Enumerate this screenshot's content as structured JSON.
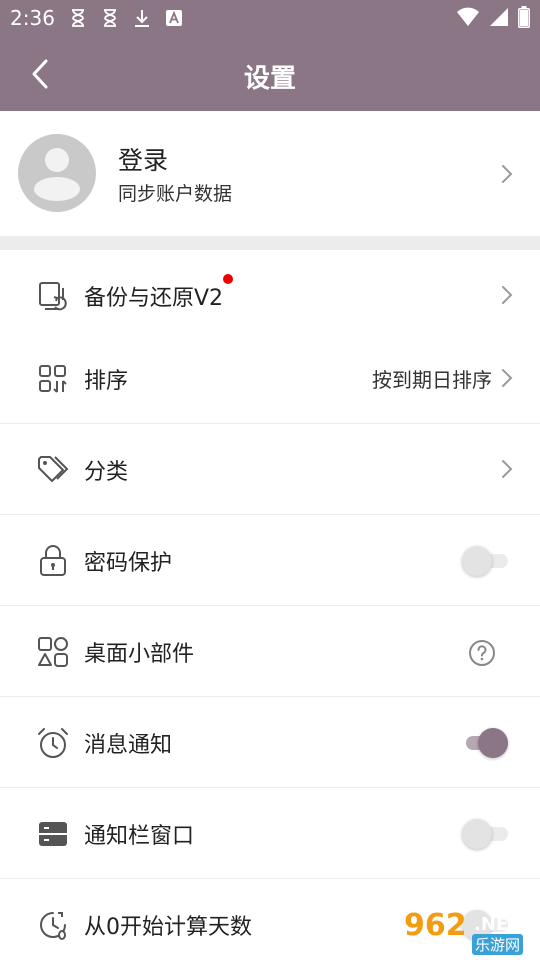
{
  "status_bar": {
    "time": "2:36",
    "left_icons": [
      "hourglass-icon",
      "hourglass-icon",
      "download-icon",
      "font-a-icon"
    ],
    "right_icons": [
      "wifi-icon",
      "signal-icon",
      "battery-icon"
    ]
  },
  "appbar": {
    "title": "设置",
    "background": "#8b7686"
  },
  "login": {
    "title": "登录",
    "subtitle": "同步账户数据"
  },
  "rows": [
    {
      "label": "备份与还原V2",
      "icon": "backup-restore-icon",
      "control": "chevron",
      "badge": "red-dot"
    },
    {
      "label": "排序",
      "icon": "sort-grid-icon",
      "control": "chevron",
      "value": "按到期日排序"
    },
    {
      "label": "分类",
      "icon": "tag-icon",
      "control": "chevron"
    },
    {
      "label": "密码保护",
      "icon": "lock-icon",
      "control": "switch",
      "on": false
    },
    {
      "label": "桌面小部件",
      "icon": "widget-shapes-icon",
      "control": "help"
    },
    {
      "label": "消息通知",
      "icon": "alarm-clock-icon",
      "control": "switch",
      "on": true
    },
    {
      "label": "通知栏窗口",
      "icon": "notification-bar-icon",
      "control": "switch",
      "on": false
    },
    {
      "label": "从0开始计算天数",
      "icon": "count-clock-icon",
      "control": "switch",
      "on": false
    }
  ],
  "watermark": {
    "number": "962",
    "suffix": ".NET",
    "site": "乐游网"
  },
  "colors": {
    "accent": "#8b7686",
    "accent_light": "#b6a8b3",
    "badge": "#e00000",
    "divider": "#ececec"
  }
}
